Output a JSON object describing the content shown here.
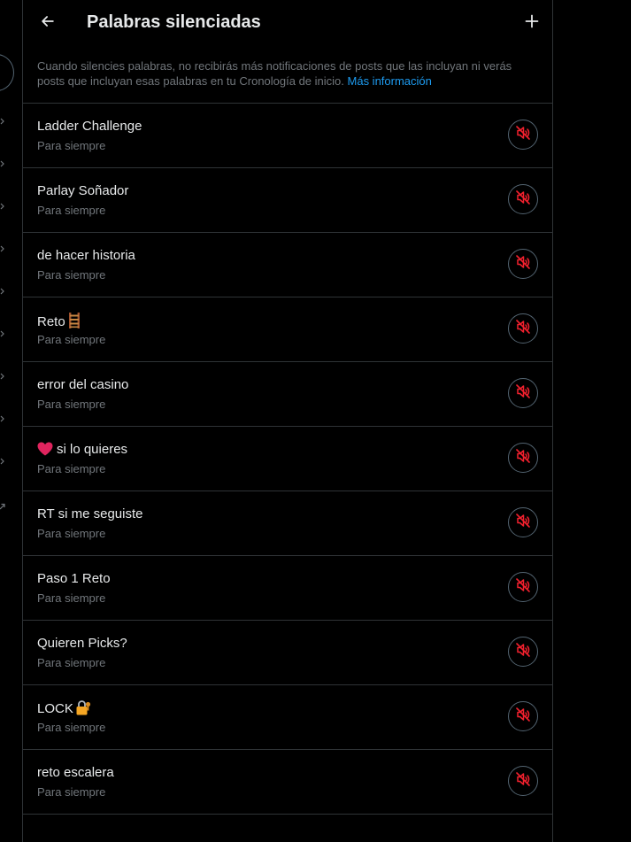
{
  "header": {
    "title": "Palabras silenciadas"
  },
  "intro": {
    "text": "Cuando silencies palabras, no recibirás más notificaciones de posts que las incluyan ni verás posts que incluyan esas palabras en tu Cronología de inicio.",
    "link_label": "Más información"
  },
  "colors": {
    "background": "#000000",
    "text_primary": "#e7e9ea",
    "text_secondary": "#71767b",
    "link": "#1d9bf0",
    "border": "#2f3336",
    "mute_icon": "#f4212e"
  },
  "muted_words": [
    {
      "word": "Ladder Challenge",
      "duration": "Para siempre"
    },
    {
      "word": "Parlay Soñador",
      "duration": "Para siempre"
    },
    {
      "word": "de hacer historia",
      "duration": "Para siempre"
    },
    {
      "word": "Reto",
      "emoji_after": "ladder",
      "duration": "Para siempre"
    },
    {
      "word": "error del casino",
      "duration": "Para siempre"
    },
    {
      "word": "si lo quieres",
      "emoji_before": "red-heart",
      "duration": "Para siempre"
    },
    {
      "word": "RT si me seguiste",
      "duration": "Para siempre"
    },
    {
      "word": "Paso 1 Reto",
      "duration": "Para siempre"
    },
    {
      "word": "Quieren Picks?",
      "duration": "Para siempre"
    },
    {
      "word": "LOCK",
      "emoji_after": "locked-with-key",
      "duration": "Para siempre"
    },
    {
      "word": "reto escalera",
      "duration": "Para siempre"
    }
  ],
  "icons": {
    "back": "arrow-left-icon",
    "add": "plus-icon",
    "unmute": "speaker-muted-icon"
  }
}
